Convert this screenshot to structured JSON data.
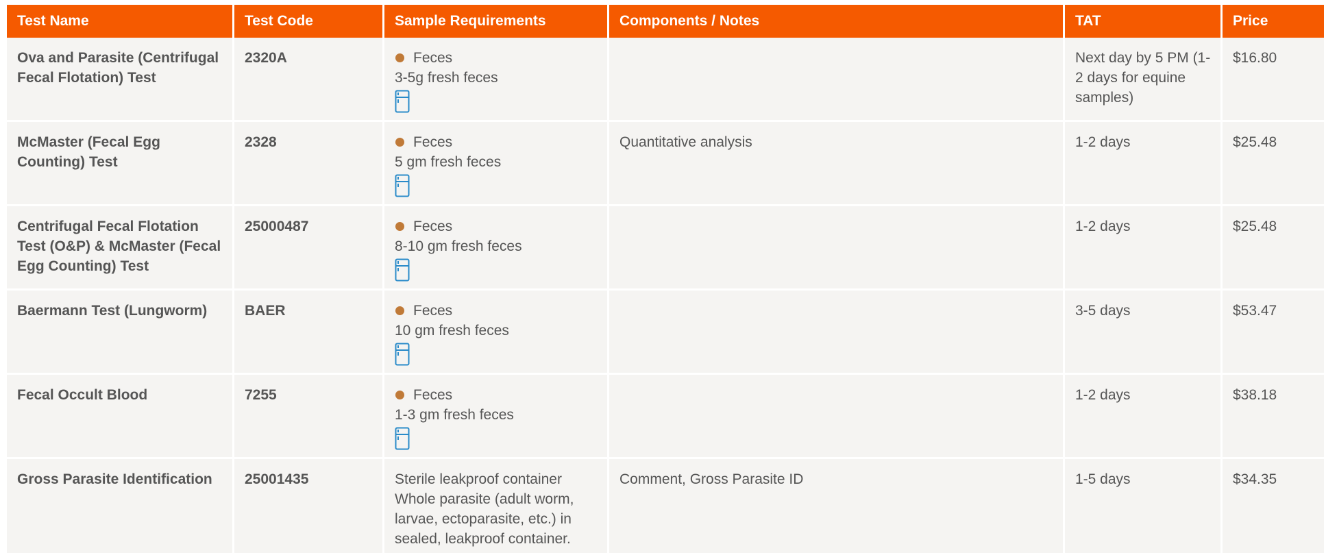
{
  "headers": {
    "test_name": "Test Name",
    "test_code": "Test Code",
    "sample_requirements": "Sample Requirements",
    "components_notes": "Components / Notes",
    "tat": "TAT",
    "price": "Price"
  },
  "rows": [
    {
      "name": "Ova and Parasite (Centrifugal Fecal Flotation) Test",
      "code": "2320A",
      "sample_type": "Feces",
      "sample_amount": "3-5g fresh feces",
      "notes": "",
      "tat": "Next day by 5 PM (1-2 days for equine samples)",
      "price": "$16.80"
    },
    {
      "name": "McMaster (Fecal Egg Counting) Test",
      "code": "2328",
      "sample_type": "Feces",
      "sample_amount": "5 gm fresh feces",
      "notes": "Quantitative analysis",
      "tat": "1-2 days",
      "price": "$25.48"
    },
    {
      "name": "Centrifugal Fecal Flotation Test (O&P) & McMaster (Fecal Egg Counting) Test",
      "code": "25000487",
      "sample_type": "Feces",
      "sample_amount": "8-10 gm fresh feces",
      "notes": "",
      "tat": "1-2 days",
      "price": "$25.48"
    },
    {
      "name": "Baermann Test (Lungworm)",
      "code": "BAER",
      "sample_type": "Feces",
      "sample_amount": "10 gm fresh feces",
      "notes": "",
      "tat": "3-5 days",
      "price": "$53.47"
    },
    {
      "name": "Fecal Occult Blood",
      "code": "7255",
      "sample_type": "Feces",
      "sample_amount": "1-3 gm fresh feces",
      "notes": "",
      "tat": "1-2 days",
      "price": "$38.18"
    },
    {
      "name": "Gross Parasite Identification",
      "code": "25001435",
      "sample_line1": "Sterile leakproof container",
      "sample_line2": "Whole parasite (adult worm, larvae, ectoparasite, etc.) in sealed, leakproof container.",
      "notes": "Comment, Gross Parasite ID",
      "tat": "1-5 days",
      "price": "$34.35"
    }
  ],
  "icons": {
    "sample_dot_color": "#c07a38",
    "refrigerate_icon": "refrigerator-icon",
    "header_color": "#f55a00",
    "refrigerator_color": "#2a8bc9"
  }
}
